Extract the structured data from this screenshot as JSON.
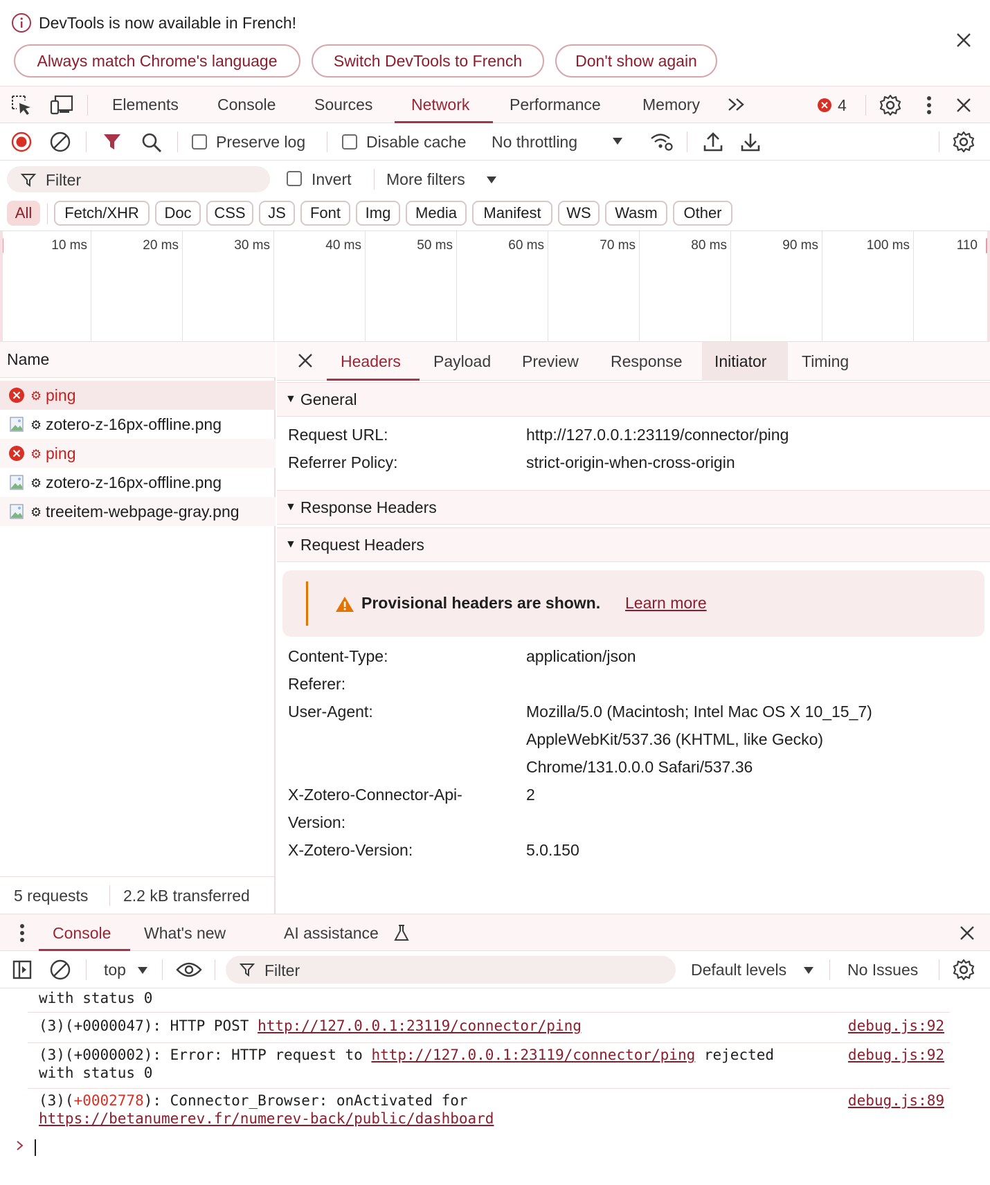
{
  "infobar": {
    "message": "DevTools is now available in French!",
    "buttons": [
      "Always match Chrome's language",
      "Switch DevTools to French",
      "Don't show again"
    ]
  },
  "main_tabs": [
    "Elements",
    "Console",
    "Sources",
    "Network",
    "Performance",
    "Memory"
  ],
  "active_main_tab": "Network",
  "issues_count": "4",
  "toolbar": {
    "preserve_log": "Preserve log",
    "disable_cache": "Disable cache",
    "throttling": "No throttling"
  },
  "filter": {
    "placeholder": "Filter",
    "invert": "Invert",
    "more_filters": "More filters"
  },
  "type_chips": [
    "All",
    "Fetch/XHR",
    "Doc",
    "CSS",
    "JS",
    "Font",
    "Img",
    "Media",
    "Manifest",
    "WS",
    "Wasm",
    "Other"
  ],
  "timeline_ticks": [
    "10 ms",
    "20 ms",
    "30 ms",
    "40 ms",
    "50 ms",
    "60 ms",
    "70 ms",
    "80 ms",
    "90 ms",
    "100 ms",
    "110"
  ],
  "requests": {
    "header": "Name",
    "items": [
      {
        "name": "ping",
        "status": "error"
      },
      {
        "name": "zotero-z-16px-offline.png",
        "status": "image"
      },
      {
        "name": "ping",
        "status": "error"
      },
      {
        "name": "zotero-z-16px-offline.png",
        "status": "image"
      },
      {
        "name": "treeitem-webpage-gray.png",
        "status": "image"
      }
    ],
    "footer_requests": "5 requests",
    "footer_transferred": "2.2 kB transferred"
  },
  "detail_tabs": [
    "Headers",
    "Payload",
    "Preview",
    "Response",
    "Initiator",
    "Timing"
  ],
  "general": {
    "title": "General",
    "request_url_label": "Request URL:",
    "request_url": "http://127.0.0.1:23119/connector/ping",
    "referrer_policy_label": "Referrer Policy:",
    "referrer_policy": "strict-origin-when-cross-origin"
  },
  "response_headers_title": "Response Headers",
  "request_headers": {
    "title": "Request Headers",
    "warning": "Provisional headers are shown.",
    "learn_more": "Learn more",
    "content_type_label": "Content-Type:",
    "content_type": "application/json",
    "referer_label": "Referer:",
    "user_agent_label": "User-Agent:",
    "user_agent_1": "Mozilla/5.0 (Macintosh; Intel Mac OS X 10_15_7)",
    "user_agent_2": "AppleWebKit/537.36 (KHTML, like Gecko)",
    "user_agent_3": "Chrome/131.0.0.0 Safari/537.36",
    "api_label_1": "X-Zotero-Connector-Api-",
    "api_label_2": "Version:",
    "api_value": "2",
    "zotero_version_label": "X-Zotero-Version:",
    "zotero_version": "5.0.150"
  },
  "drawer": {
    "tabs": [
      "Console",
      "What's new",
      "AI assistance"
    ],
    "context": "top",
    "filter_placeholder": "Filter",
    "levels": "Default levels",
    "issues": "No Issues"
  },
  "console": {
    "line0": "with status 0",
    "line1_prefix": "(3)(+0000047): HTTP POST ",
    "line1_link": "http://127.0.0.1:23119/connector/ping",
    "line1_src": "debug.js:92",
    "line2_prefix": "(3)(+0000002): Error: HTTP request to ",
    "line2_link": "http://127.0.0.1:23119/connector/ping",
    "line2_suffix": " rejected",
    "line2_cont": "with status 0",
    "line2_src": "debug.js:92",
    "line3_a": "(3)(",
    "line3_red": "+0002778",
    "line3_b": "): Connector_Browser: onActivated for",
    "line3_link": "https://betanumerev.fr/numerev-back/public/dashboard",
    "line3_src": "debug.js:89"
  },
  "colors": {
    "accent": "#9c2433",
    "error": "#c5221f",
    "warning": "#e37400"
  }
}
